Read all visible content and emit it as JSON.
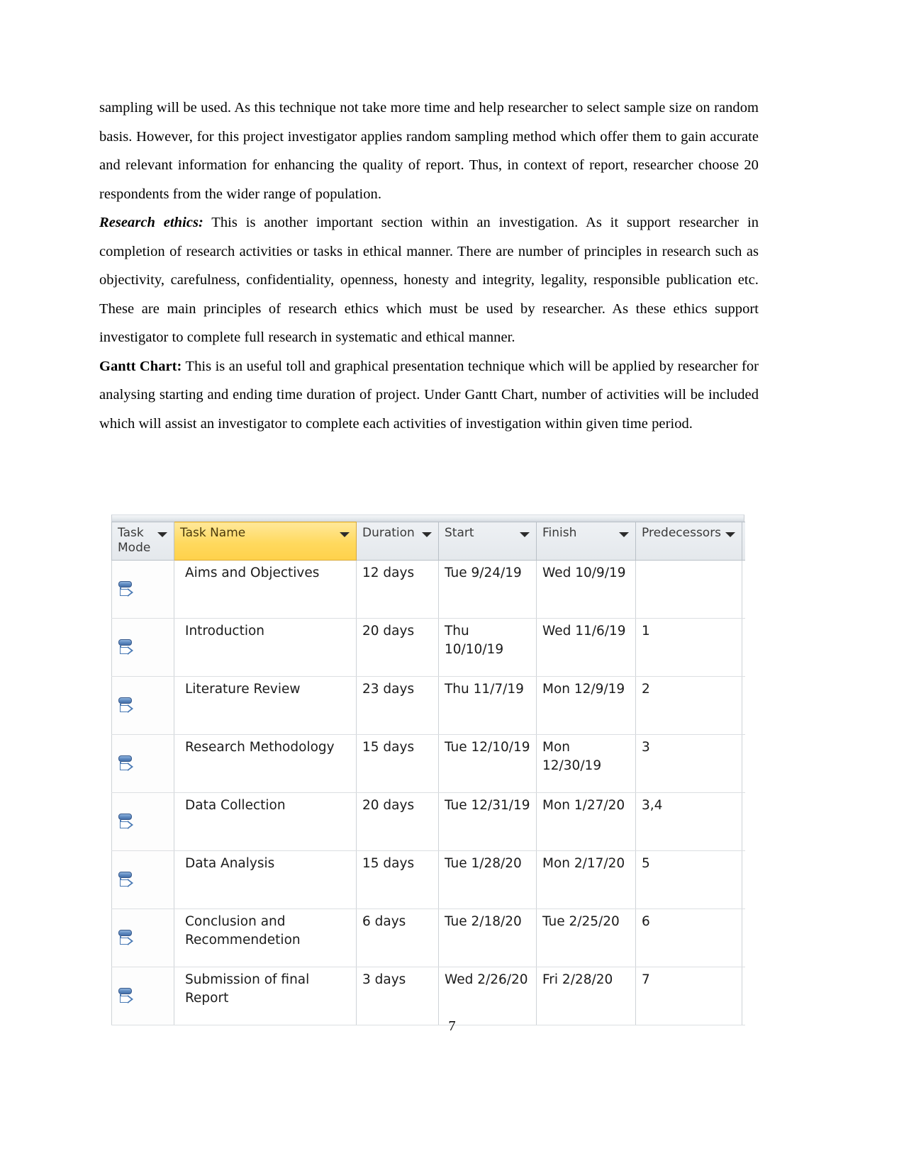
{
  "document": {
    "page_number": "7",
    "paragraphs": [
      {
        "id": "p1",
        "text": "sampling will be used. As this technique not take more time and help researcher to select sample size on random basis. However, for this project investigator applies random sampling method which offer them to gain accurate and relevant information for enhancing the quality of report. Thus, in context of report, researcher choose 20 respondents from the wider range of population."
      },
      {
        "id": "p2",
        "lead": "Research ethics:",
        "lead_style": "bold-italic",
        "text": " This is another important section within an investigation. As it support researcher in completion of research activities or tasks in ethical manner. There are number of principles in research such as objectivity, carefulness, confidentiality, openness, honesty and integrity, legality, responsible publication etc. These are main principles of research ethics which must be used by researcher. As these ethics support investigator to complete full research in systematic and ethical manner."
      },
      {
        "id": "p3",
        "lead": "Gantt Chart:",
        "lead_style": "bold",
        "text": " This is an useful toll and graphical presentation technique which will be applied by researcher for analysing starting and ending time duration of project. Under Gantt Chart, number of activities will be included which will assist an investigator to complete each activities of investigation within given time period."
      }
    ]
  },
  "gantt_table": {
    "highlight_color": "#ffd95e",
    "headers": [
      {
        "label": "Task Mode",
        "highlighted": false,
        "has_sort_arrow": true
      },
      {
        "label": "Task Name",
        "highlighted": true,
        "has_sort_arrow": true
      },
      {
        "label": "Duration",
        "highlighted": false,
        "has_sort_arrow": true
      },
      {
        "label": "Start",
        "highlighted": false,
        "has_sort_arrow": true
      },
      {
        "label": "Finish",
        "highlighted": false,
        "has_sort_arrow": true
      },
      {
        "label": "Predecessors",
        "highlighted": false,
        "has_sort_arrow": true
      }
    ],
    "rows": [
      {
        "mode_icon": "auto-scheduled-icon",
        "name": "Aims and Objectives",
        "duration": "12 days",
        "start": "Tue 9/24/19",
        "finish": "Wed 10/9/19",
        "predecessors": ""
      },
      {
        "mode_icon": "auto-scheduled-icon",
        "name": "Introduction",
        "duration": "20 days",
        "start": "Thu 10/10/19",
        "finish": "Wed 11/6/19",
        "predecessors": "1"
      },
      {
        "mode_icon": "auto-scheduled-icon",
        "name": "Literature Review",
        "duration": "23 days",
        "start": "Thu 11/7/19",
        "finish": "Mon 12/9/19",
        "predecessors": "2"
      },
      {
        "mode_icon": "auto-scheduled-icon",
        "name": "Research Methodology",
        "duration": "15 days",
        "start": "Tue 12/10/19",
        "finish": "Mon 12/30/19",
        "predecessors": "3"
      },
      {
        "mode_icon": "auto-scheduled-icon",
        "name": "Data Collection",
        "duration": "20 days",
        "start": "Tue 12/31/19",
        "finish": "Mon 1/27/20",
        "predecessors": "3,4"
      },
      {
        "mode_icon": "auto-scheduled-icon",
        "name": "Data Analysis",
        "duration": "15 days",
        "start": "Tue 1/28/20",
        "finish": "Mon 2/17/20",
        "predecessors": "5"
      },
      {
        "mode_icon": "auto-scheduled-icon",
        "name": "Conclusion and\nRecommendetion",
        "duration": "6 days",
        "start": "Tue 2/18/20",
        "finish": "Tue 2/25/20",
        "predecessors": "6"
      },
      {
        "mode_icon": "auto-scheduled-icon",
        "name": "Submission of final\nReport",
        "duration": "3 days",
        "start": "Wed 2/26/20",
        "finish": "Fri 2/28/20",
        "predecessors": "7"
      }
    ]
  }
}
